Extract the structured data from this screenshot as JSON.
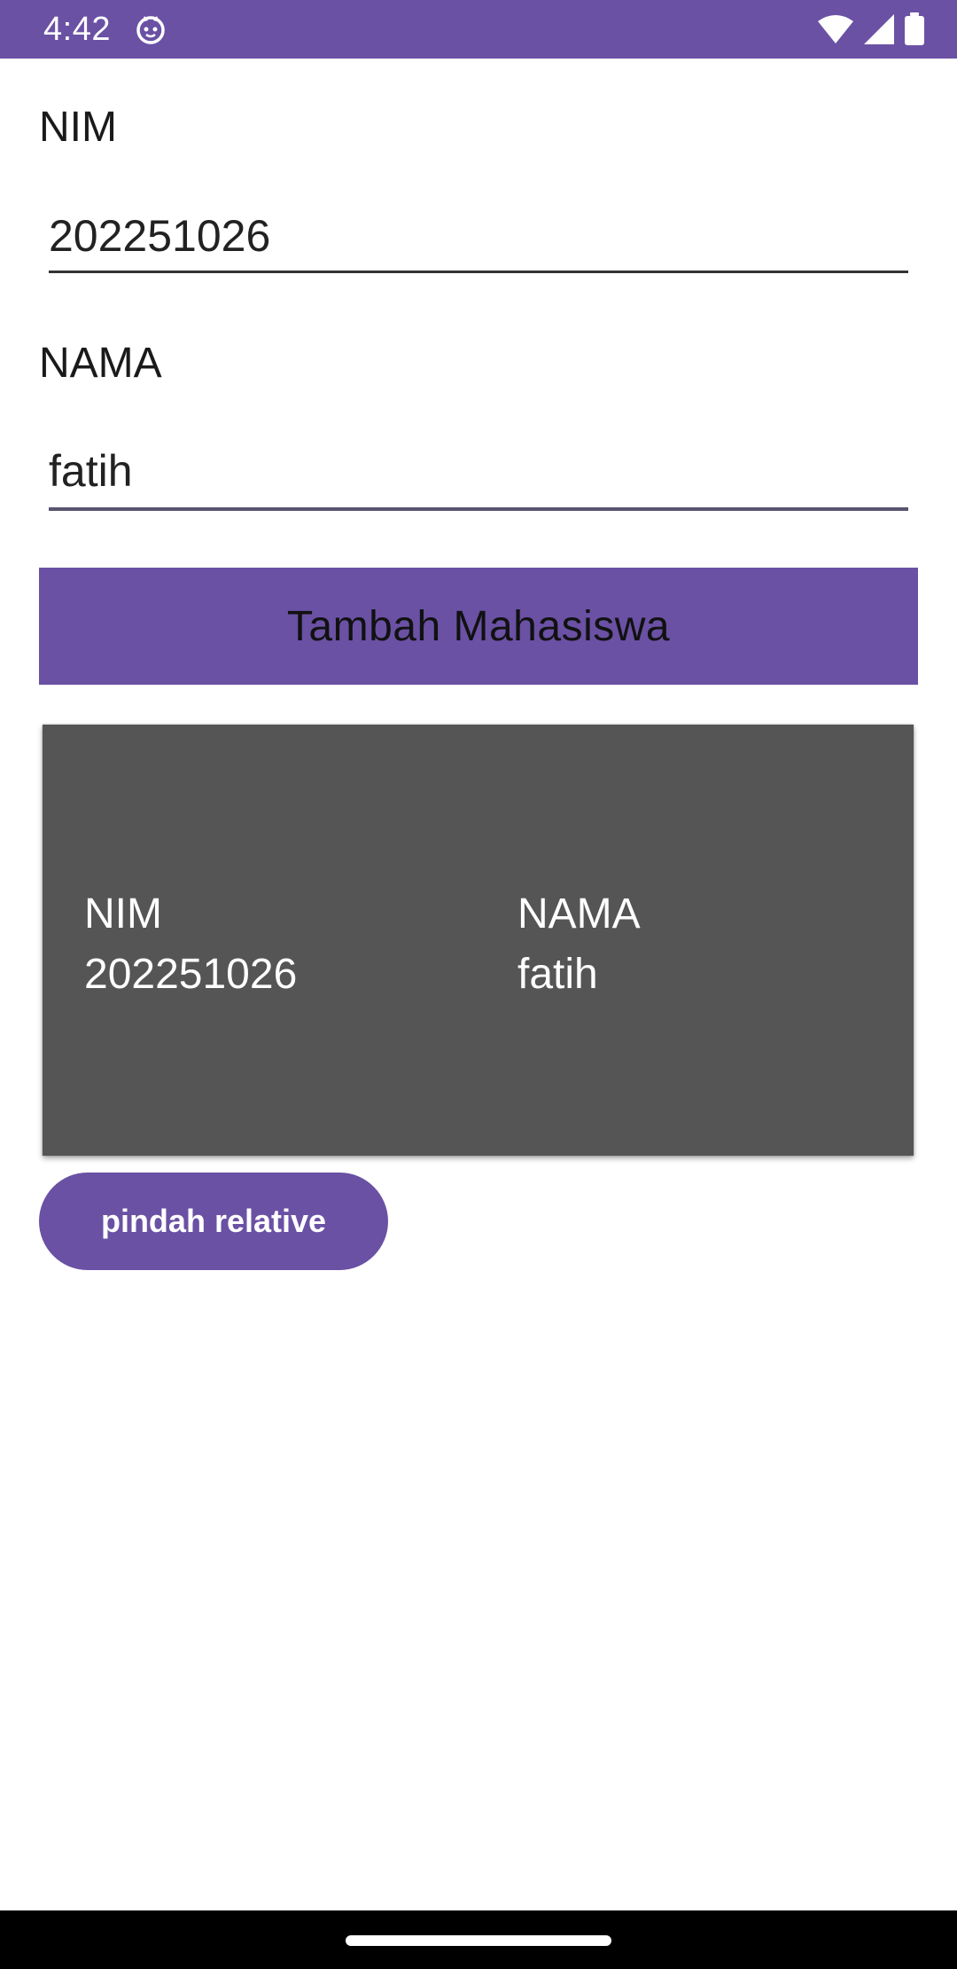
{
  "status_bar": {
    "time": "4:42",
    "app_icon": "android-cat-icon",
    "icons": [
      "wifi-icon",
      "cellular-signal-icon",
      "battery-icon"
    ],
    "color": "#6a51a4"
  },
  "form": {
    "nim_label": "NIM",
    "nim_value": "202251026",
    "nama_label": "NAMA",
    "nama_value": "fatih",
    "add_button_label": "Tambah Mahasiswa"
  },
  "card": {
    "nim_header": "NIM",
    "nim_value": "202251026",
    "nama_header": "NAMA",
    "nama_value": "fatih",
    "background": "#555555"
  },
  "navigate_button_label": "pindah relative",
  "accent_color": "#6a51a4"
}
